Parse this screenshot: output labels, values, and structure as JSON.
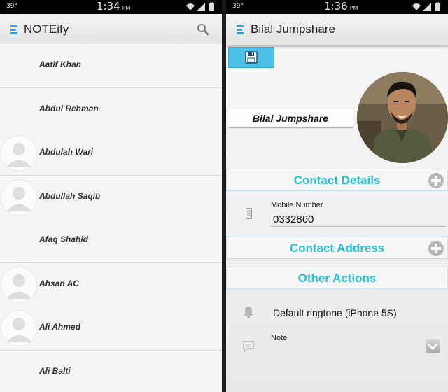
{
  "status_left": {
    "temperature": "39°",
    "time": "1:34",
    "ampm": "PM"
  },
  "status_right": {
    "temperature": "39°",
    "time": "1:36",
    "ampm": "PM"
  },
  "list_screen": {
    "app_title": "NOTEify",
    "contacts": [
      {
        "name": "Aatif Khan",
        "avatar": false
      },
      {
        "name": "Abdul Rehman",
        "avatar": false
      },
      {
        "name": "Abdulah Wari",
        "avatar": true
      },
      {
        "name": "Abdullah Saqib",
        "avatar": true
      },
      {
        "name": "Afaq Shahid",
        "avatar": false
      },
      {
        "name": "Ahsan AC",
        "avatar": true
      },
      {
        "name": "Ali Ahmed",
        "avatar": true
      },
      {
        "name": "Ali Balti",
        "avatar": false
      }
    ]
  },
  "detail_screen": {
    "title": "Bilal Jumpshare",
    "name_field": "Bilal Jumpshare",
    "sections": {
      "contact_details": "Contact Details",
      "contact_address": "Contact Address",
      "other_actions": "Other Actions"
    },
    "mobile_label": "Mobile Number",
    "mobile_value": "0332860",
    "ringtone": "Default ringtone (iPhone 5S)",
    "note_label": "Note"
  },
  "colors": {
    "accent": "#29c0d2",
    "drawer_icon": "#2d9fd8",
    "save_button": "#4fc0e8"
  }
}
